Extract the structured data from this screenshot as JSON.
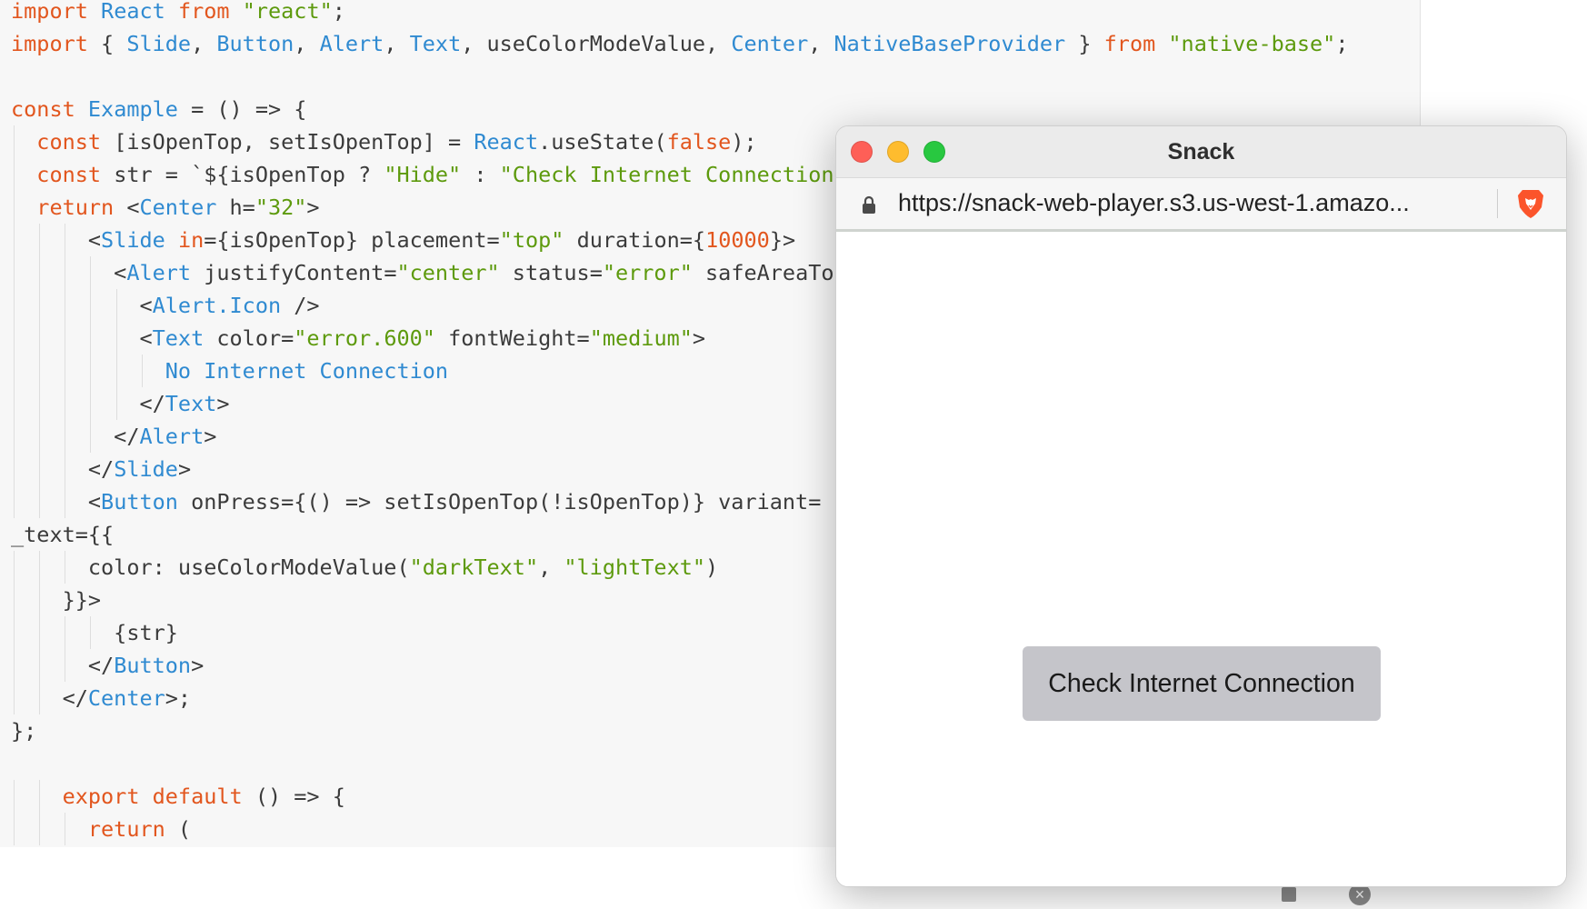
{
  "editor": {
    "lines": [
      [
        {
          "t": "import",
          "c": "kw"
        },
        {
          "t": " ",
          "c": "plain"
        },
        {
          "t": "React",
          "c": "id"
        },
        {
          "t": " ",
          "c": "plain"
        },
        {
          "t": "from",
          "c": "kw"
        },
        {
          "t": " ",
          "c": "plain"
        },
        {
          "t": "\"react\"",
          "c": "str"
        },
        {
          "t": ";",
          "c": "plain"
        }
      ],
      [
        {
          "t": "import",
          "c": "kw"
        },
        {
          "t": " { ",
          "c": "plain"
        },
        {
          "t": "Slide",
          "c": "id"
        },
        {
          "t": ", ",
          "c": "plain"
        },
        {
          "t": "Button",
          "c": "id"
        },
        {
          "t": ", ",
          "c": "plain"
        },
        {
          "t": "Alert",
          "c": "id"
        },
        {
          "t": ", ",
          "c": "plain"
        },
        {
          "t": "Text",
          "c": "id"
        },
        {
          "t": ", useColorModeValue, ",
          "c": "plain"
        },
        {
          "t": "Center",
          "c": "id"
        },
        {
          "t": ", ",
          "c": "plain"
        },
        {
          "t": "NativeBaseProvider",
          "c": "id"
        },
        {
          "t": " } ",
          "c": "plain"
        },
        {
          "t": "from",
          "c": "kw"
        },
        {
          "t": " ",
          "c": "plain"
        },
        {
          "t": "\"native-base\"",
          "c": "str"
        },
        {
          "t": ";",
          "c": "plain"
        }
      ],
      [],
      [
        {
          "t": "const",
          "c": "kw"
        },
        {
          "t": " ",
          "c": "plain"
        },
        {
          "t": "Example",
          "c": "id"
        },
        {
          "t": " = () => {",
          "c": "plain"
        }
      ],
      [
        {
          "t": "  ",
          "c": "plain"
        },
        {
          "t": "const",
          "c": "kw"
        },
        {
          "t": " [isOpenTop, setIsOpenTop] = ",
          "c": "plain"
        },
        {
          "t": "React",
          "c": "id"
        },
        {
          "t": ".useState(",
          "c": "plain"
        },
        {
          "t": "false",
          "c": "kw"
        },
        {
          "t": ");",
          "c": "plain"
        }
      ],
      [
        {
          "t": "  ",
          "c": "plain"
        },
        {
          "t": "const",
          "c": "kw"
        },
        {
          "t": " str = `${isOpenTop ? ",
          "c": "plain"
        },
        {
          "t": "\"Hide\"",
          "c": "str"
        },
        {
          "t": " : ",
          "c": "plain"
        },
        {
          "t": "\"Check Internet Connection\"",
          "c": "str"
        }
      ],
      [
        {
          "t": "  ",
          "c": "plain"
        },
        {
          "t": "return",
          "c": "kw"
        },
        {
          "t": " <",
          "c": "plain"
        },
        {
          "t": "Center",
          "c": "id"
        },
        {
          "t": " h=",
          "c": "plain"
        },
        {
          "t": "\"32\"",
          "c": "str"
        },
        {
          "t": ">",
          "c": "plain"
        }
      ],
      [
        {
          "t": "      <",
          "c": "plain"
        },
        {
          "t": "Slide",
          "c": "id"
        },
        {
          "t": " ",
          "c": "plain"
        },
        {
          "t": "in",
          "c": "kw"
        },
        {
          "t": "={isOpenTop} placement=",
          "c": "plain"
        },
        {
          "t": "\"top\"",
          "c": "str"
        },
        {
          "t": " duration={",
          "c": "plain"
        },
        {
          "t": "10000",
          "c": "num"
        },
        {
          "t": "}>",
          "c": "plain"
        }
      ],
      [
        {
          "t": "        <",
          "c": "plain"
        },
        {
          "t": "Alert",
          "c": "id"
        },
        {
          "t": " justifyContent=",
          "c": "plain"
        },
        {
          "t": "\"center\"",
          "c": "str"
        },
        {
          "t": " status=",
          "c": "plain"
        },
        {
          "t": "\"error\"",
          "c": "str"
        },
        {
          "t": " safeAreaTop",
          "c": "plain"
        }
      ],
      [
        {
          "t": "          <",
          "c": "plain"
        },
        {
          "t": "Alert.Icon",
          "c": "id"
        },
        {
          "t": " />",
          "c": "plain"
        }
      ],
      [
        {
          "t": "          <",
          "c": "plain"
        },
        {
          "t": "Text",
          "c": "id"
        },
        {
          "t": " color=",
          "c": "plain"
        },
        {
          "t": "\"error.600\"",
          "c": "str"
        },
        {
          "t": " fontWeight=",
          "c": "plain"
        },
        {
          "t": "\"medium\"",
          "c": "str"
        },
        {
          "t": ">",
          "c": "plain"
        }
      ],
      [
        {
          "t": "            ",
          "c": "plain"
        },
        {
          "t": "No Internet Connection",
          "c": "id"
        }
      ],
      [
        {
          "t": "          </",
          "c": "plain"
        },
        {
          "t": "Text",
          "c": "id"
        },
        {
          "t": ">",
          "c": "plain"
        }
      ],
      [
        {
          "t": "        </",
          "c": "plain"
        },
        {
          "t": "Alert",
          "c": "id"
        },
        {
          "t": ">",
          "c": "plain"
        }
      ],
      [
        {
          "t": "      </",
          "c": "plain"
        },
        {
          "t": "Slide",
          "c": "id"
        },
        {
          "t": ">",
          "c": "plain"
        }
      ],
      [
        {
          "t": "      <",
          "c": "plain"
        },
        {
          "t": "Button",
          "c": "id"
        },
        {
          "t": " onPress={() => setIsOpenTop(!isOpenTop)} variant=",
          "c": "plain"
        }
      ],
      [
        {
          "t": "_text={{",
          "c": "plain"
        }
      ],
      [
        {
          "t": "      color: useColorModeValue(",
          "c": "plain"
        },
        {
          "t": "\"darkText\"",
          "c": "str"
        },
        {
          "t": ", ",
          "c": "plain"
        },
        {
          "t": "\"lightText\"",
          "c": "str"
        },
        {
          "t": ")",
          "c": "plain"
        }
      ],
      [
        {
          "t": "    }}>",
          "c": "plain"
        }
      ],
      [
        {
          "t": "        {str}",
          "c": "plain"
        }
      ],
      [
        {
          "t": "      </",
          "c": "plain"
        },
        {
          "t": "Button",
          "c": "id"
        },
        {
          "t": ">",
          "c": "plain"
        }
      ],
      [
        {
          "t": "    </",
          "c": "plain"
        },
        {
          "t": "Center",
          "c": "id"
        },
        {
          "t": ">;",
          "c": "plain"
        }
      ],
      [
        {
          "t": "};",
          "c": "plain"
        }
      ],
      [],
      [
        {
          "t": "    ",
          "c": "plain"
        },
        {
          "t": "export",
          "c": "kw"
        },
        {
          "t": " ",
          "c": "plain"
        },
        {
          "t": "default",
          "c": "kw"
        },
        {
          "t": " () => {",
          "c": "plain"
        }
      ],
      [
        {
          "t": "      ",
          "c": "plain"
        },
        {
          "t": "return",
          "c": "kw"
        },
        {
          "t": " (",
          "c": "plain"
        }
      ]
    ],
    "colors": {
      "keyword": "#e2561e",
      "string": "#5d9a0d",
      "identifier": "#2f8ad1",
      "text": "#3b3b3b"
    }
  },
  "snack": {
    "title": "Snack",
    "url": "https://snack-web-player.s3.us-west-1.amazo...",
    "button_label": "Check Internet Connection",
    "icons": {
      "lock": "lock-icon",
      "shield": "brave-lion-icon"
    }
  }
}
